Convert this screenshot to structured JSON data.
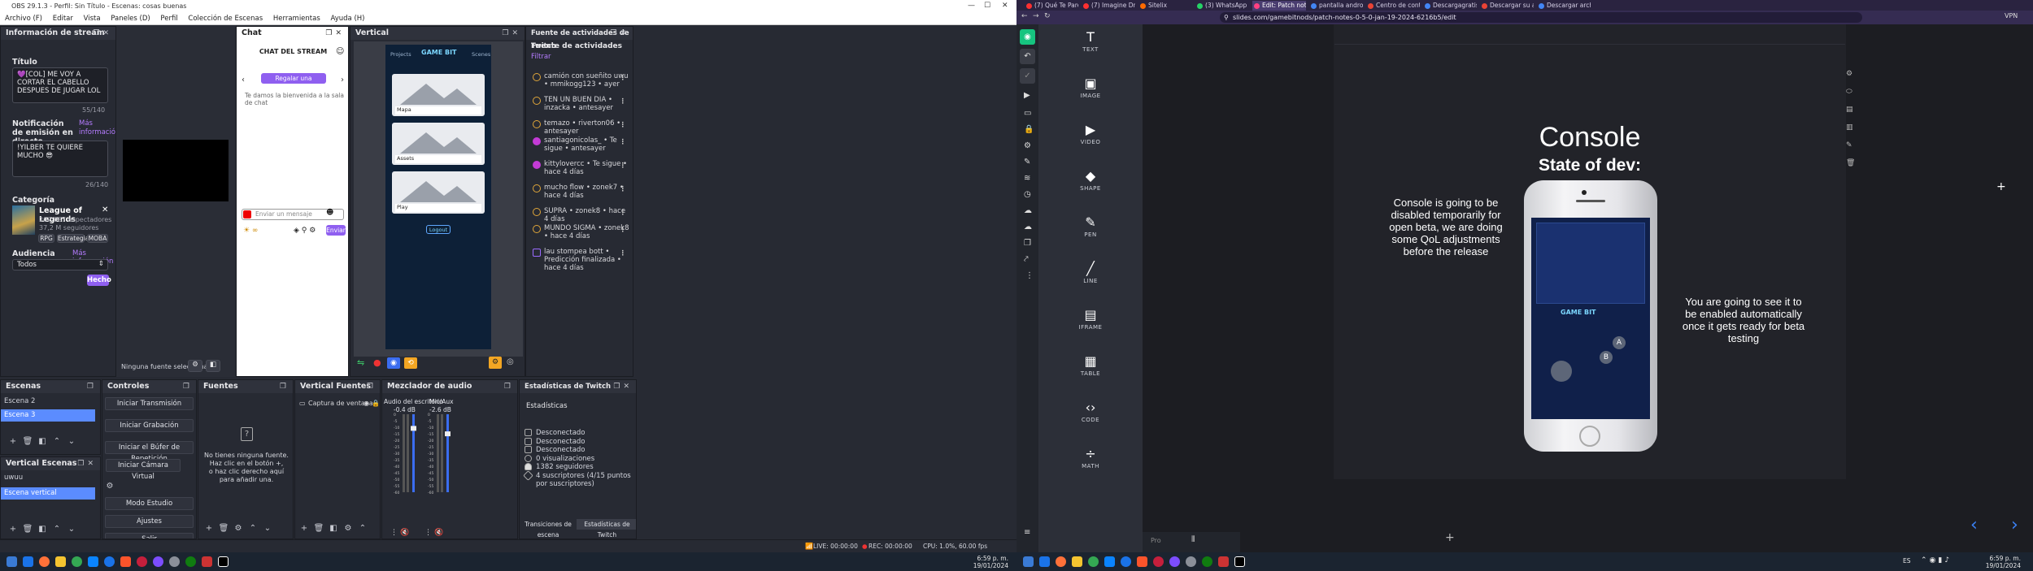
{
  "obs": {
    "window_title": "OBS 29.1.3 - Perfil: Sin Título - Escenas: cosas buenas",
    "menu": [
      "Archivo (F)",
      "Editar",
      "Vista",
      "Paneles (D)",
      "Perfil",
      "Colección de Escenas",
      "Herramientas",
      "Ayuda (H)"
    ],
    "stream_info": {
      "title": "Información de stream",
      "title_label": "Título",
      "title_value": "💜[COL] ME VOY A CORTAR EL CABELLO DESPUES DE JUGAR LOL",
      "title_count": "55/140",
      "notif_label": "Notificación de emisión en directo",
      "more_info": "Más información",
      "notif_value": "!YILBER TE QUIERE MUCHO 😎",
      "notif_count": "26/140",
      "category_label": "Categoría",
      "game_name": "League of Legends",
      "game_viewers": "207.087 espectadores",
      "game_followers": "37,2 M seguidores",
      "tags": [
        "RPG",
        "Estrategia",
        "MOBA"
      ],
      "audience_label": "Audiencia",
      "audience_more": "Más información",
      "audience_value": "Todos",
      "done_button": "Hecho"
    },
    "preview": {
      "no_source": "Ninguna fuente seleccionada"
    },
    "chat": {
      "dock_title": "Chat",
      "header": "CHAT DEL STREAM",
      "gift_button": "Regalar una suscripción",
      "welcome": "Te damos la bienvenida a la sala de chat",
      "input_placeholder": "Enviar un mensaje",
      "send_button": "Enviar"
    },
    "vertical": {
      "dock_title": "Vertical",
      "brand": "GAME BIT",
      "nav_left": "Projects",
      "nav_right": "Scenes",
      "cards": [
        {
          "label": "Mapa"
        },
        {
          "label": "Assets"
        },
        {
          "label": "Play"
        }
      ],
      "logout": "Logout"
    },
    "activity": {
      "dock_title": "Fuente de actividades de Twitch",
      "subtitle": "Fuente de actividades",
      "filter": "Filtrar",
      "items": [
        {
          "text": "camión con sueñito uwu • mmikogg123 • ayer",
          "kind": "points"
        },
        {
          "text": "TEN UN BUEN DIA • inzacka • antesayer",
          "kind": "points"
        },
        {
          "text": "temazo • riverton06 • antesayer",
          "kind": "points"
        },
        {
          "text": "santiagonicolas_ • Te sigue • antesayer",
          "kind": "follow"
        },
        {
          "text": "kittylovercc • Te sigue • hace 4 días",
          "kind": "follow"
        },
        {
          "text": "mucho flow • zonek7 • hace 4 días",
          "kind": "points"
        },
        {
          "text": "SUPRA • zonek8 • hace 4 días",
          "kind": "points"
        },
        {
          "text": "MUNDO SIGMA • zonek8 • hace 4 días",
          "kind": "points"
        },
        {
          "text": "lau stompea bott • Predicción finalizada • hace 4 días",
          "kind": "prediction"
        }
      ]
    },
    "scenes": {
      "dock_title": "Escenas",
      "items": [
        "Escena 2",
        "Escena 3"
      ],
      "selected": "Escena 3"
    },
    "vertical_scenes": {
      "dock_title": "Vertical Escenas",
      "items": [
        "uwuu",
        "Escena vertical"
      ],
      "selected": "Escena vertical"
    },
    "controls": {
      "dock_title": "Controles",
      "buttons": [
        "Iniciar Transmisión",
        "Iniciar Grabación",
        "Iniciar el Búfer de Repetición",
        "Iniciar Cámara Virtual",
        "Modo Estudio",
        "Ajustes",
        "Salir"
      ]
    },
    "sources": {
      "dock_title": "Fuentes",
      "empty_title": "No tienes ninguna fuente.",
      "empty_line2": "Haz clic en el botón +,",
      "empty_line3": "o haz clic derecho aquí para añadir una."
    },
    "vertical_sources": {
      "dock_title": "Vertical Fuentes",
      "item": "Captura de ventana"
    },
    "mixer": {
      "dock_title": "Mezclador de audio",
      "channels": [
        {
          "name": "Audio del escritorio",
          "db": "-0.4 dB",
          "level": 0.85
        },
        {
          "name": "Mic/Aux",
          "db": "-2.6 dB",
          "level": 0.78
        }
      ],
      "scale": [
        "0",
        "-5",
        "-10",
        "-15",
        "-20",
        "-25",
        "-30",
        "-35",
        "-40",
        "-45",
        "-50",
        "-55",
        "-60"
      ]
    },
    "twitch_stats": {
      "dock_title": "Estadísticas de Twitch",
      "subtitle": "Estadísticas",
      "rows": [
        "Desconectado",
        "Desconectado",
        "Desconectado",
        "0 visualizaciones",
        "1382 seguidores",
        "4 suscriptores (4/15 puntos por suscriptores)"
      ],
      "tab_transitions": "Transiciones de escena",
      "tab_stats": "Estadísticas de Twitch"
    },
    "status_bar": {
      "live": "LIVE: 00:00:00",
      "rec": "REC: 00:00:00",
      "cpu": "CPU: 1.0%, 60.00 fps"
    }
  },
  "taskbar_left": {
    "time": "6:59 p. m.",
    "date": "19/01/2024"
  },
  "taskbar_right": {
    "lang": "ES",
    "time": "6:59 p. m.",
    "date": "19/01/2024"
  },
  "chrome": {
    "tabs": [
      {
        "title": "(7) Qué Te Parece - Mi...",
        "color": "#ff3030"
      },
      {
        "title": "(7) Imagine Dragons Pl...",
        "color": "#ff3030"
      },
      {
        "title": "Sitelix",
        "color": "#ff6a00"
      },
      {
        "title": "(3) WhatsApp",
        "color": "#25d366"
      },
      {
        "title": "Edit: Patch notes",
        "color": "#ff4081"
      },
      {
        "title": "pantalla android png -...",
        "color": "#4285f4"
      },
      {
        "title": "Centro de control cam...",
        "color": "#ea4335"
      },
      {
        "title": "Descargagratis | Desc...",
        "color": "#4285f4"
      },
      {
        "title": "Descargar su archivo...",
        "color": "#ea4335"
      },
      {
        "title": "Descargar archivo | Ev...",
        "color": "#4285f4"
      }
    ],
    "active_tab": 4,
    "url": "slides.com/gamebitnods/patch-notes-0-5-0-jan-19-2024-6216b5/edit",
    "vpn": "VPN"
  },
  "slides": {
    "tools": [
      {
        "label": "TEXT",
        "icon": "text-icon",
        "glyph": "T"
      },
      {
        "label": "IMAGE",
        "icon": "image-icon",
        "glyph": "▣"
      },
      {
        "label": "VIDEO",
        "icon": "video-icon",
        "glyph": "▶"
      },
      {
        "label": "SHAPE",
        "icon": "shape-icon",
        "glyph": "◆"
      },
      {
        "label": "PEN",
        "icon": "pen-icon",
        "glyph": "✎"
      },
      {
        "label": "LINE",
        "icon": "line-icon",
        "glyph": "╱"
      },
      {
        "label": "IFRAME",
        "icon": "iframe-icon",
        "glyph": "▤"
      },
      {
        "label": "TABLE",
        "icon": "table-icon",
        "glyph": "▦"
      },
      {
        "label": "CODE",
        "icon": "code-icon",
        "glyph": "‹›"
      },
      {
        "label": "MATH",
        "icon": "math-icon",
        "glyph": "÷"
      }
    ],
    "heading": "Console",
    "subheading": "State of dev:",
    "left_text": "Console is going to be disabled temporarily for open beta, we are doing some QoL adjustments before the release",
    "right_text": "You are going to see it to be enabled automatically once it gets ready for beta testing",
    "phone_brand": "GAME BIT",
    "phone_button_a": "A",
    "phone_button_b": "B",
    "notes_placeholder": "Pro"
  }
}
